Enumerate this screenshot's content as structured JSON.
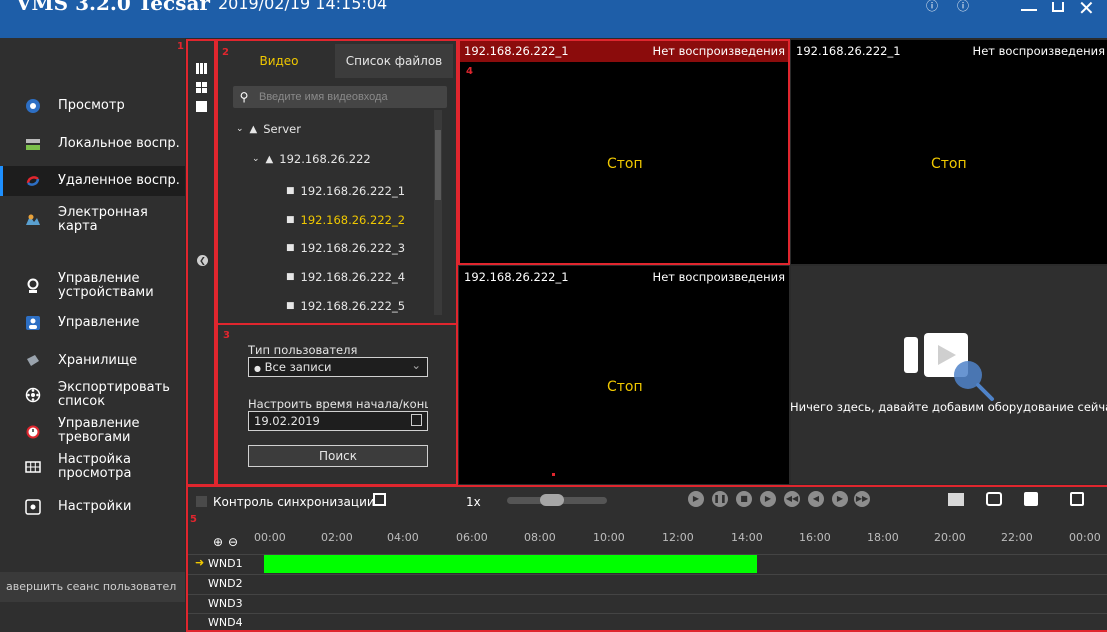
{
  "titlebar": {
    "app_title": "VMS 3.2.0 Tecsar",
    "datetime": "2019/02/19 14:15:04",
    "icons": [
      "info-icon",
      "help-icon",
      "minimize-icon",
      "restore-icon",
      "close-icon"
    ]
  },
  "sidebar": {
    "items": [
      {
        "label": "Просмотр",
        "icon": "eye-icon"
      },
      {
        "label": "Локальное воспр.",
        "icon": "local-playback-icon"
      },
      {
        "label": "Удаленное воспр.",
        "icon": "remote-playback-icon",
        "active": true
      },
      {
        "label": "Электронная карта",
        "icon": "map-icon"
      },
      {
        "label": "Управление устройствами",
        "icon": "device-icon"
      },
      {
        "label": "Управление",
        "icon": "user-icon"
      },
      {
        "label": "Хранилище",
        "icon": "storage-icon"
      },
      {
        "label": "Экспортировать список",
        "icon": "export-icon"
      },
      {
        "label": "Управление тревогами",
        "icon": "alarm-icon"
      },
      {
        "label": "Настройка просмотра",
        "icon": "grid-icon"
      },
      {
        "label": "Настройки",
        "icon": "settings-icon"
      }
    ],
    "logout_label": "авершить сеанс пользовател"
  },
  "markers": [
    "1",
    "2",
    "3",
    "4",
    "5"
  ],
  "device_panel": {
    "tabs": [
      "Видео",
      "Список файлов"
    ],
    "search_placeholder": "Введите имя видеовхода",
    "tree": {
      "root": "Server",
      "device": "192.168.26.222",
      "channels": [
        "192.168.26.222_1",
        "192.168.26.222_2",
        "192.168.26.222_3",
        "192.168.26.222_4",
        "192.168.26.222_5"
      ],
      "selected_channel": "192.168.26.222_2"
    }
  },
  "search_panel": {
    "user_type_label": "Тип пользователя",
    "user_type_value": "Все записи",
    "time_label": "Настроить время начала/конца",
    "date_value": "19.02.2019",
    "search_button": "Поиск"
  },
  "video_windows": [
    {
      "name": "192.168.26.222_1",
      "status": "Нет воспроизведения",
      "state": "Стоп",
      "selected": true
    },
    {
      "name": "192.168.26.222_1",
      "status": "Нет воспроизведения",
      "state": "Стоп"
    },
    {
      "name": "192.168.26.222_1",
      "status": "Нет воспроизведения",
      "state": "Стоп"
    }
  ],
  "empty_window": {
    "message": "Ничего здесь, давайте добавим оборудование сейчас!"
  },
  "playback": {
    "sync_label": "Контроль синхронизации",
    "speed": "1x",
    "buttons": [
      "play-icon",
      "pause-icon",
      "stop-icon",
      "step-forward-icon",
      "rewind-icon",
      "previous-icon",
      "next-icon",
      "fast-forward-icon"
    ],
    "right_icons": [
      "layout-select-icon",
      "snapshot-icon",
      "folder-icon",
      "fullscreen-icon"
    ]
  },
  "timeline": {
    "hours": [
      "00:00",
      "02:00",
      "04:00",
      "06:00",
      "08:00",
      "10:00",
      "12:00",
      "14:00",
      "16:00",
      "18:00",
      "20:00",
      "22:00",
      "00:00"
    ],
    "rows": [
      "WND1",
      "WND2",
      "WND3",
      "WND4"
    ],
    "recording": {
      "row": "WND1",
      "start": "00:00",
      "end": "14:00",
      "color": "#00ff00"
    }
  },
  "colors": {
    "titlebar": "#1e5ea8",
    "highlight": "#e0262e",
    "accent_text": "#f0c800",
    "recording": "#00ff00"
  }
}
